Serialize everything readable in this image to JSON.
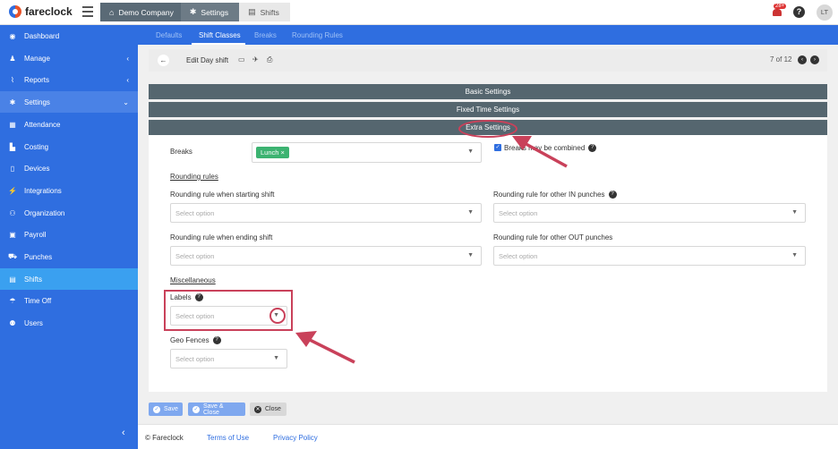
{
  "app": {
    "brand": "fareclock"
  },
  "breadcrumb": [
    "Demo Company",
    "Settings",
    "Shifts"
  ],
  "topbar": {
    "notification_count": "28+",
    "help": "?",
    "avatar_initials": "LT"
  },
  "sidebar": {
    "items": [
      {
        "label": "Dashboard",
        "icon": "dashboard-icon",
        "glyph": "◉"
      },
      {
        "label": "Manage",
        "icon": "person-icon",
        "glyph": "♟",
        "chevron": "‹"
      },
      {
        "label": "Reports",
        "icon": "chart-icon",
        "glyph": "⌇",
        "chevron": "‹"
      },
      {
        "label": "Settings",
        "icon": "gear-icon",
        "glyph": "✱",
        "chevron": "⌄"
      },
      {
        "label": "Attendance",
        "icon": "attendance-icon",
        "glyph": "▦"
      },
      {
        "label": "Costing",
        "icon": "costing-icon",
        "glyph": "▙"
      },
      {
        "label": "Devices",
        "icon": "device-icon",
        "glyph": "▯"
      },
      {
        "label": "Integrations",
        "icon": "plug-icon",
        "glyph": "⚡"
      },
      {
        "label": "Organization",
        "icon": "org-icon",
        "glyph": "⚇"
      },
      {
        "label": "Payroll",
        "icon": "payroll-icon",
        "glyph": "▣"
      },
      {
        "label": "Punches",
        "icon": "punch-icon",
        "glyph": "⛟"
      },
      {
        "label": "Shifts",
        "icon": "calendar-icon",
        "glyph": "▤"
      },
      {
        "label": "Time Off",
        "icon": "time-off-icon",
        "glyph": "☂"
      },
      {
        "label": "Users",
        "icon": "users-icon",
        "glyph": "⚉"
      }
    ],
    "collapse": "‹"
  },
  "subtabs": [
    "Defaults",
    "Shift Classes",
    "Breaks",
    "Rounding Rules"
  ],
  "header": {
    "title": "Edit Day shift",
    "pager": "7 of 12"
  },
  "sections": [
    "Basic Settings",
    "Fixed Time Settings",
    "Extra Settings"
  ],
  "form": {
    "breaks_label": "Breaks",
    "breaks_tag": "Lunch",
    "breaks_combine": "Breaks may be combined",
    "rounding_heading": "Rounding rules",
    "start_label": "Rounding rule when starting shift",
    "other_in_label": "Rounding rule for other IN punches",
    "end_label": "Rounding rule when ending shift",
    "other_out_label": "Rounding rule for other OUT punches",
    "misc_heading": "Miscellaneous",
    "labels_label": "Labels",
    "geo_label": "Geo Fences",
    "placeholder": "Select option"
  },
  "buttons": {
    "save": "Save",
    "save_close": "Save & Close",
    "close": "Close"
  },
  "footer": {
    "copyright": "© Fareclock",
    "terms": "Terms of Use",
    "privacy": "Privacy Policy"
  },
  "colors": {
    "primary": "#2f6ee0",
    "section": "#55666f",
    "annotation": "#c9415a",
    "tag": "#3cb371"
  }
}
